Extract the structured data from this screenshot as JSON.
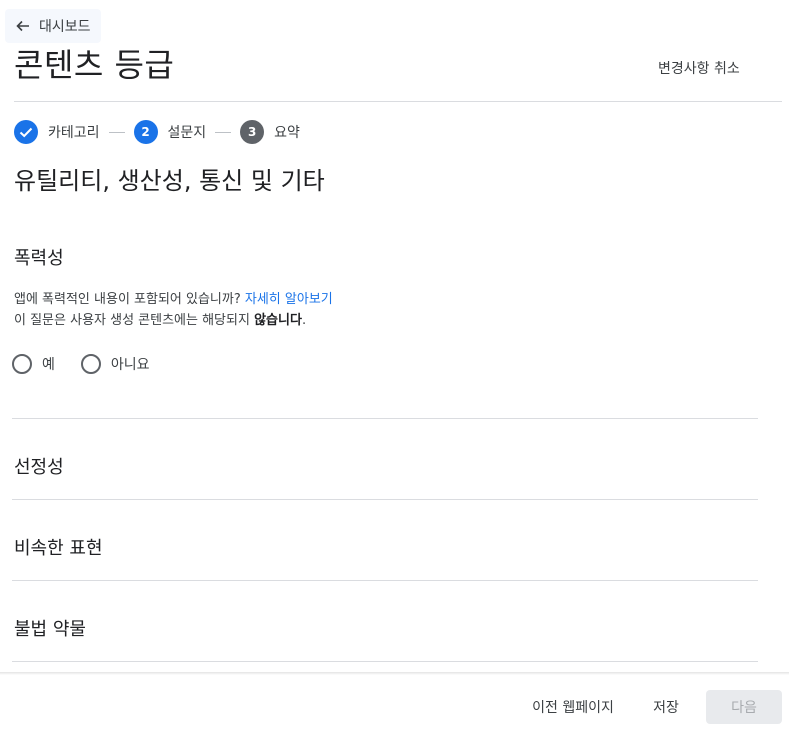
{
  "header": {
    "back_label": "대시보드",
    "title": "콘텐츠 등급",
    "discard_label": "변경사항 취소"
  },
  "stepper": {
    "steps": [
      {
        "number": "",
        "label": "카테고리",
        "state": "complete"
      },
      {
        "number": "2",
        "label": "설문지",
        "state": "current"
      },
      {
        "number": "3",
        "label": "요약",
        "state": "upcoming"
      }
    ]
  },
  "section": {
    "title": "유틸리티, 생산성, 통신 및 기타"
  },
  "questions": {
    "violence": {
      "heading": "폭력성",
      "question_text": "앱에 폭력적인 내용이 포함되어 있습니까?",
      "learn_more": "자세히 알아보기",
      "note_prefix": "이 질문은 사용자 생성 콘텐츠에는 해당되지",
      "note_bold": "않습니다",
      "note_suffix": ".",
      "options": [
        "예",
        "아니요"
      ]
    },
    "sexuality": {
      "heading": "선정성"
    },
    "language": {
      "heading": "비속한 표현"
    },
    "drugs": {
      "heading": "불법 약물"
    }
  },
  "footer": {
    "previous_label": "이전 웹페이지",
    "save_label": "저장",
    "next_label": "다음"
  },
  "colors": {
    "accent": "#1a73e8",
    "step_grey": "#5f6368",
    "divider": "#dadce0"
  },
  "icons": [
    "arrow-left-icon",
    "check-icon"
  ]
}
